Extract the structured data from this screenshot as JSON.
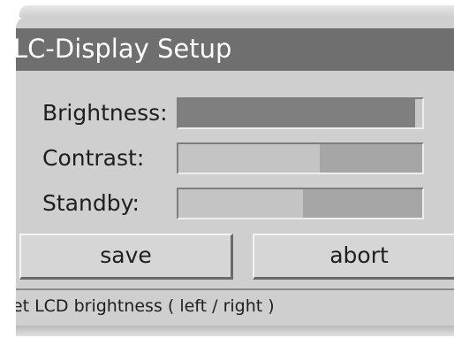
{
  "dialog": {
    "title": "LC-Display Setup"
  },
  "settings": [
    {
      "label": "Brightness:",
      "level": 0.97,
      "selected": true
    },
    {
      "label": "Contrast:",
      "level": 0.58,
      "selected": false
    },
    {
      "label": "Standby:",
      "level": 0.51,
      "selected": false
    }
  ],
  "buttons": {
    "save_label": "save",
    "abort_label": "abort"
  },
  "status": {
    "hint": "set LCD brightness ( left / right )"
  },
  "colors": {
    "title_bar": "#6f6f6f",
    "panel": "#cfcfcf",
    "selected_fill": "#7f7f7f",
    "track": "#c4c4c4"
  }
}
